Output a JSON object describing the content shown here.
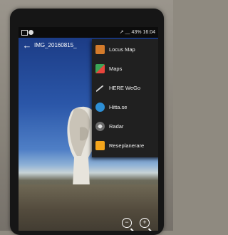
{
  "status_bar": {
    "signal": "↗ ⸏ 43%",
    "time": "16:04"
  },
  "header": {
    "back_glyph": "←",
    "title": "IMG_20160815_"
  },
  "share_menu": {
    "items": [
      {
        "label": "Locus Map",
        "icon": "locus-map-icon",
        "color": "#d47b2b"
      },
      {
        "label": "Maps",
        "icon": "google-maps-icon",
        "color": "#3aa557"
      },
      {
        "label": "HERE WeGo",
        "icon": "here-wego-icon",
        "color": "#d9d9d9"
      },
      {
        "label": "Hitta.se",
        "icon": "hitta-icon",
        "color": "#2d8fd6"
      },
      {
        "label": "Radar",
        "icon": "radar-icon",
        "color": "#9c9c9c"
      },
      {
        "label": "Reseplanerare",
        "icon": "reseplanerare-icon",
        "color": "#f4a51c"
      }
    ]
  },
  "zoom": {
    "out": "−",
    "in": "+"
  }
}
